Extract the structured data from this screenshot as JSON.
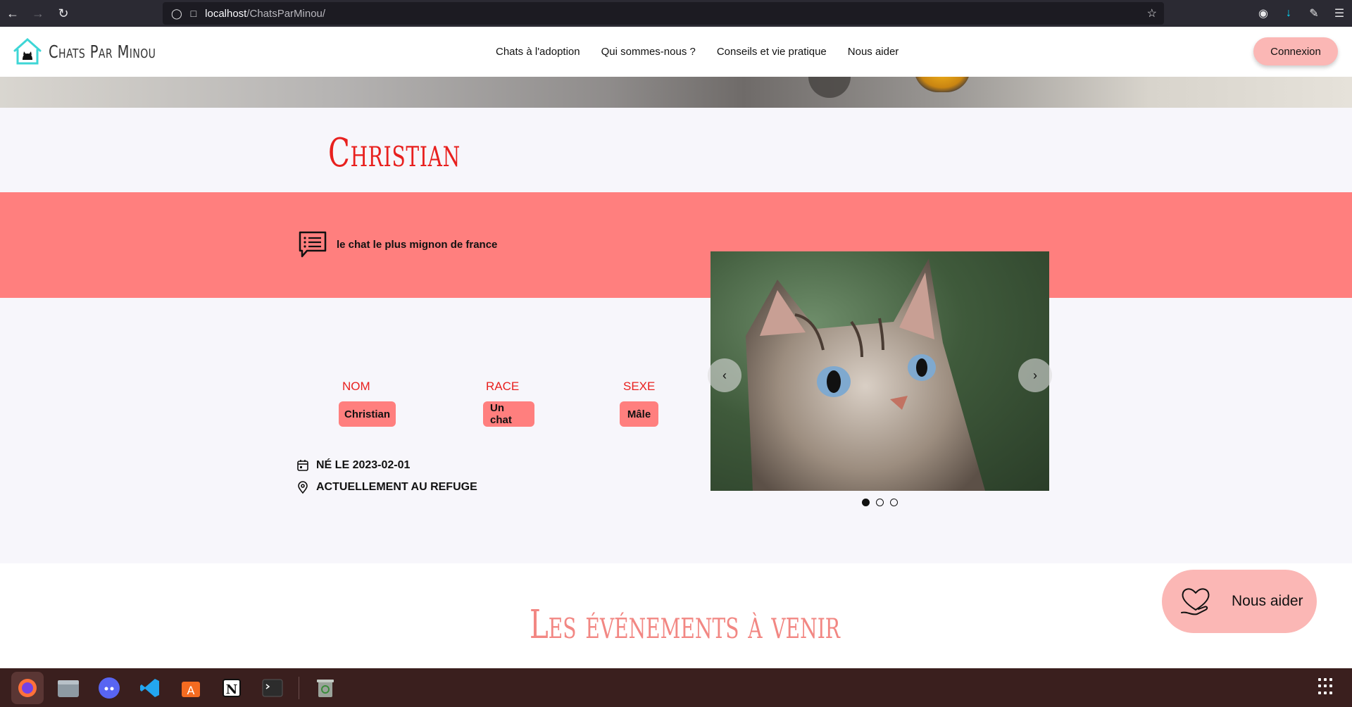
{
  "browser": {
    "url_host": "localhost",
    "url_path": "/ChatsParMinou/"
  },
  "header": {
    "site_name": "Chats Par Minou",
    "nav": [
      "Chats à l'adoption",
      "Qui sommes-nous ?",
      "Conseils et vie pratique",
      "Nous aider"
    ],
    "login_label": "Connexion"
  },
  "cat": {
    "title": "Christian",
    "description": "le chat le plus mignon de france",
    "attributes": [
      {
        "label": "Nom",
        "value": "Christian"
      },
      {
        "label": "Race",
        "value": "Un chat"
      },
      {
        "label": "Sexe",
        "value": "Mâle"
      }
    ],
    "birth": "Né le 2023-02-01",
    "location": "Actuellement au refuge",
    "carousel": {
      "total": 3,
      "active": 1,
      "prev_icon": "chevron-left-icon",
      "next_icon": "chevron-right-icon"
    }
  },
  "events": {
    "title": "Les événements à venir"
  },
  "help_button": {
    "label": "Nous aider",
    "icon": "heart-hand-icon"
  },
  "colors": {
    "accent_red": "#e8201e",
    "band_pink": "#ff7f7e",
    "button_pink": "#fbb7b5",
    "events_title": "#f28783"
  },
  "taskbar": {
    "apps": [
      "firefox-icon",
      "files-icon",
      "discord-icon",
      "vscode-icon",
      "app-center-icon",
      "notion-icon",
      "terminal-icon",
      "trash-icon"
    ]
  }
}
